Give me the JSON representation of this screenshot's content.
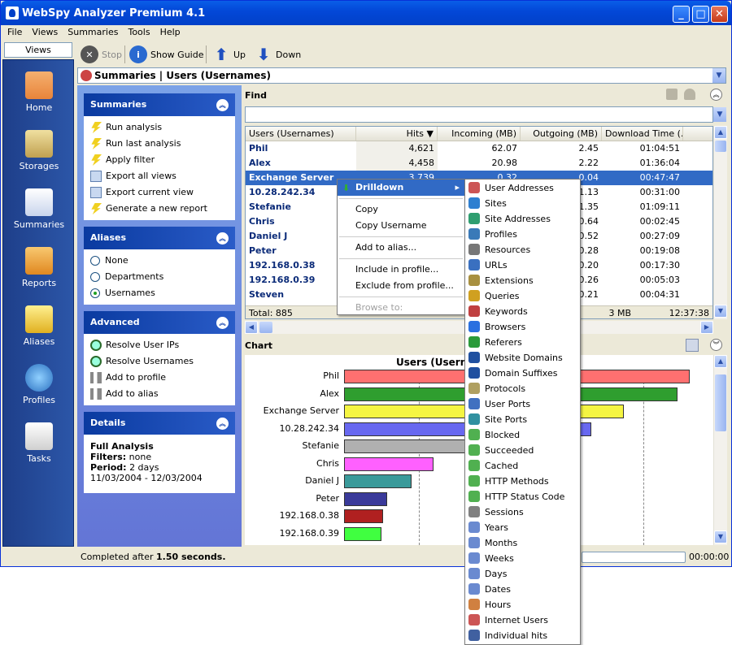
{
  "window": {
    "title": "WebSpy Analyzer Premium 4.1"
  },
  "menu": [
    "File",
    "Views",
    "Summaries",
    "Tools",
    "Help"
  ],
  "views_tab": "Views",
  "nav": [
    {
      "label": "Home",
      "icon": "house-icon",
      "color": "#e8843a"
    },
    {
      "label": "Storages",
      "icon": "storage-icon",
      "color": "#d8c06a"
    },
    {
      "label": "Summaries",
      "icon": "summaries-icon",
      "color": "#e9eef8"
    },
    {
      "label": "Reports",
      "icon": "reports-icon",
      "color": "#f0a030"
    },
    {
      "label": "Aliases",
      "icon": "aliases-icon",
      "color": "#f7d24a"
    },
    {
      "label": "Profiles",
      "icon": "profiles-icon",
      "color": "#4aa0e0"
    },
    {
      "label": "Tasks",
      "icon": "tasks-icon",
      "color": "#f0f0f0"
    }
  ],
  "toolbar": {
    "stop": "Stop",
    "guide": "Show Guide",
    "up": "Up",
    "down": "Down"
  },
  "breadcrumb": "Summaries | Users (Usernames)",
  "panels": {
    "summaries": {
      "title": "Summaries",
      "items": [
        "Run analysis",
        "Run last analysis",
        "Apply filter",
        "Export all views",
        "Export current view",
        "Generate a new report"
      ]
    },
    "aliases": {
      "title": "Aliases",
      "options": [
        "None",
        "Departments",
        "Usernames"
      ],
      "selected": 2
    },
    "advanced": {
      "title": "Advanced",
      "items": [
        "Resolve User IPs",
        "Resolve Usernames",
        "Add to profile",
        "Add to alias"
      ]
    },
    "details": {
      "title": "Details",
      "heading": "Full Analysis",
      "filters_label": "Filters:",
      "filters_value": "none",
      "period_label": "Period:",
      "period_value": "2 days",
      "dates": "11/03/2004 - 12/03/2004"
    }
  },
  "find": {
    "label": "Find",
    "value": ""
  },
  "grid": {
    "columns": [
      "Users (Usernames)",
      "Hits",
      "Incoming (MB)",
      "Outgoing (MB)",
      "Download Time (..."
    ],
    "rows": [
      [
        "Phil",
        "4,621",
        "62.07",
        "2.45",
        "01:04:51"
      ],
      [
        "Alex",
        "4,458",
        "20.98",
        "2.22",
        "01:36:04"
      ],
      [
        "Exchange Server",
        "3,739",
        "0.32",
        "0.04",
        "00:47:47"
      ],
      [
        "10.28.242.34",
        "",
        "",
        "1.13",
        "00:31:00"
      ],
      [
        "Stefanie",
        "",
        "",
        "1.35",
        "01:09:11"
      ],
      [
        "Chris",
        "",
        "",
        "0.64",
        "00:02:45"
      ],
      [
        "Daniel J",
        "",
        "",
        "0.52",
        "00:27:09"
      ],
      [
        "Peter",
        "",
        "",
        "0.28",
        "00:19:08"
      ],
      [
        "192.168.0.38",
        "",
        "",
        "0.20",
        "00:17:30"
      ],
      [
        "192.168.0.39",
        "",
        "",
        "0.26",
        "00:05:03"
      ],
      [
        "Steven",
        "",
        "",
        "0.21",
        "00:04:31"
      ]
    ],
    "selected_row": 2,
    "total": {
      "label": "Total: 885",
      "outgoing": "3 MB",
      "time": "12:37:38"
    }
  },
  "chart_label": "Chart",
  "chart_data": {
    "type": "bar",
    "orientation": "horizontal",
    "title": "Users (Usern",
    "categories": [
      "Phil",
      "Alex",
      "Exchange Server",
      "10.28.242.34",
      "Stefanie",
      "Chris",
      "Daniel J",
      "Peter",
      "192.168.0.38",
      "192.168.0.39"
    ],
    "values": [
      4621,
      4458,
      3739,
      3300,
      2800,
      1200,
      900,
      580,
      520,
      500
    ],
    "colors": [
      "#ff7070",
      "#2f9e2f",
      "#f5f542",
      "#6868f0",
      "#b0b0b0",
      "#ff60ff",
      "#3a9a9a",
      "#3a3a9a",
      "#b02020",
      "#40ff40"
    ],
    "xlim": [
      0,
      5000
    ],
    "grid": true
  },
  "status": {
    "prefix": "Completed after ",
    "value": "1.50 seconds.",
    "timer": "00:00:00"
  },
  "context_menu": {
    "items": [
      "Drilldown",
      "Copy",
      "Copy Username",
      "Add to alias...",
      "Include in profile...",
      "Exclude from profile...",
      "Browse to:"
    ]
  },
  "submenu": [
    {
      "label": "User Addresses",
      "color": "#cc5555"
    },
    {
      "label": "Sites",
      "color": "#2f7fd0"
    },
    {
      "label": "Site Addresses",
      "color": "#2f9e6f"
    },
    {
      "label": "Profiles",
      "color": "#3a7ab8"
    },
    {
      "label": "Resources",
      "color": "#777777"
    },
    {
      "label": "URLs",
      "color": "#3a70c0"
    },
    {
      "label": "Extensions",
      "color": "#a89040"
    },
    {
      "label": "Queries",
      "color": "#d0a020"
    },
    {
      "label": "Keywords",
      "color": "#c04040"
    },
    {
      "label": "Browsers",
      "color": "#2a70e0"
    },
    {
      "label": "Referers",
      "color": "#2a9a3a"
    },
    {
      "label": "Website Domains",
      "color": "#2050a0"
    },
    {
      "label": "Domain Suffixes",
      "color": "#2050a0"
    },
    {
      "label": "Protocols",
      "color": "#b0a060"
    },
    {
      "label": "User Ports",
      "color": "#4070c0"
    },
    {
      "label": "Site Ports",
      "color": "#3090a0"
    },
    {
      "label": "Blocked",
      "color": "#50b050"
    },
    {
      "label": "Succeeded",
      "color": "#50b050"
    },
    {
      "label": "Cached",
      "color": "#50b050"
    },
    {
      "label": "HTTP Methods",
      "color": "#50b050"
    },
    {
      "label": "HTTP Status Code",
      "color": "#50b050"
    },
    {
      "label": "Sessions",
      "color": "#808080"
    },
    {
      "label": "Years",
      "color": "#6a8ad0"
    },
    {
      "label": "Months",
      "color": "#6a8ad0"
    },
    {
      "label": "Weeks",
      "color": "#6a8ad0"
    },
    {
      "label": "Days",
      "color": "#6a8ad0"
    },
    {
      "label": "Dates",
      "color": "#6a8ad0"
    },
    {
      "label": "Hours",
      "color": "#d08040"
    },
    {
      "label": "Internet Users",
      "color": "#cc5555"
    },
    {
      "label": "Individual hits",
      "color": "#4060a0"
    }
  ]
}
